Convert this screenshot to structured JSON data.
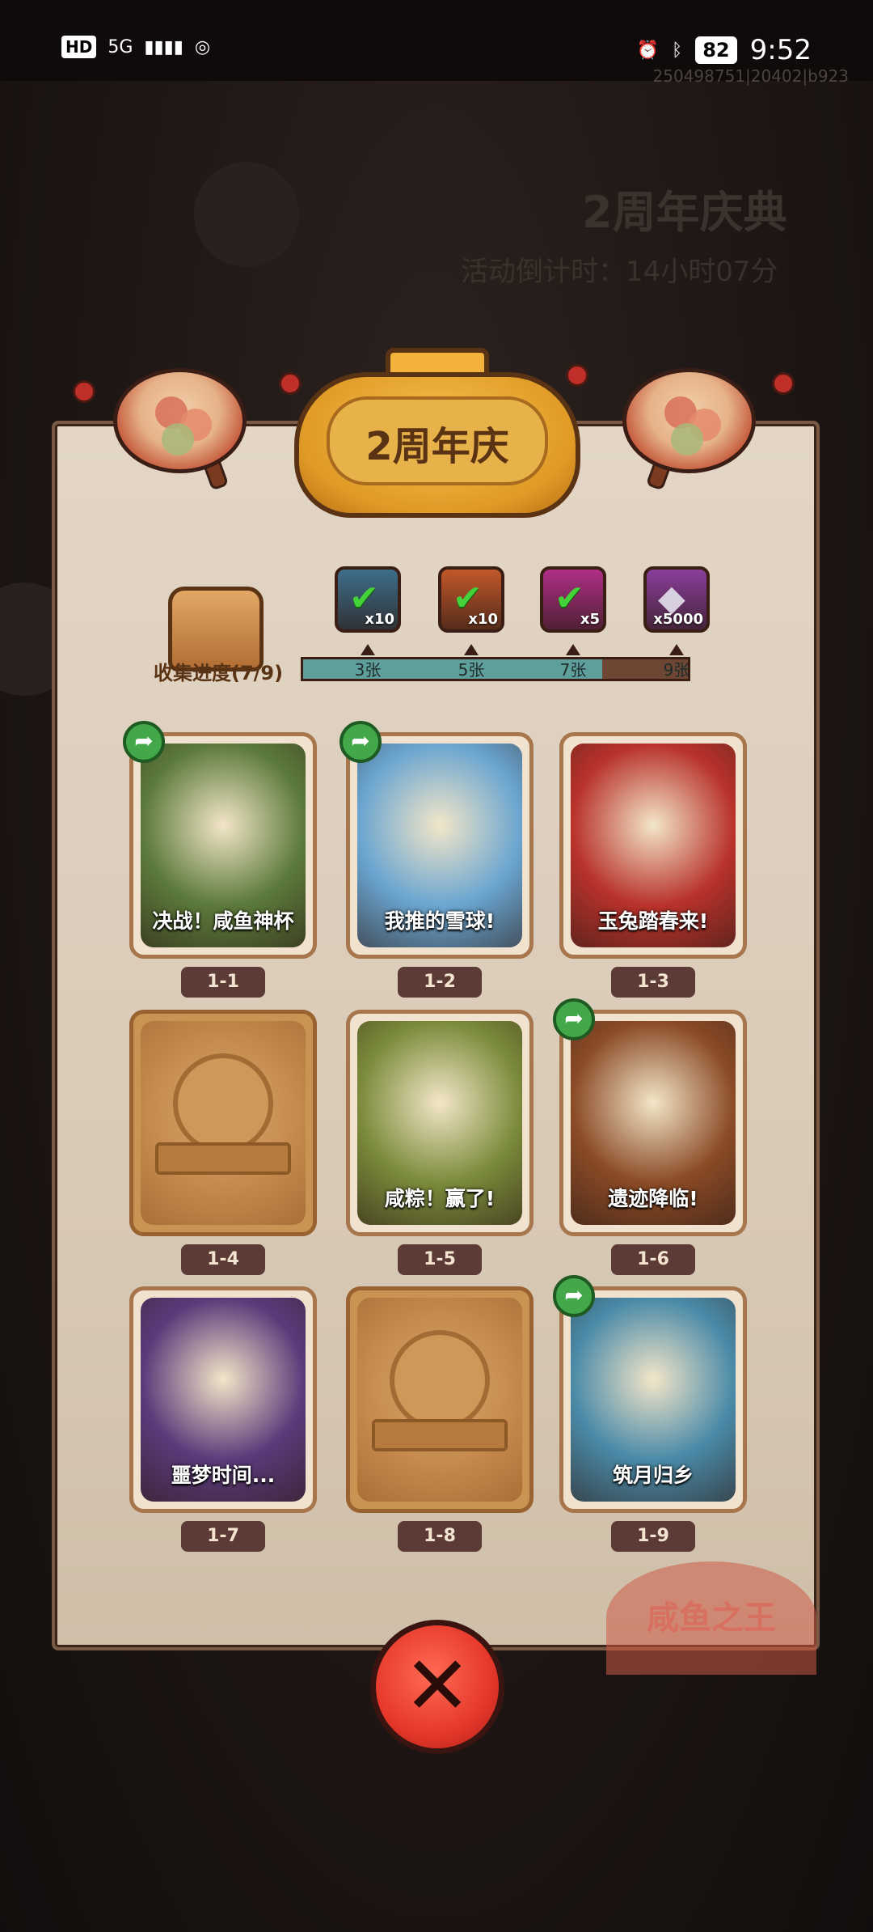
{
  "status_bar": {
    "hd": "HD",
    "signal": "5G",
    "time": "9:52",
    "battery": "82",
    "watermark": "250498751|20402|b923"
  },
  "background": {
    "event_title": "2周年庆典",
    "countdown": "活动倒计时：14小时07分"
  },
  "panel": {
    "title": "2周年庆",
    "collect_label": "收集进度(7/9)",
    "collected": 7,
    "total": 9,
    "rewards": [
      {
        "icon": "key-chest-icon",
        "qty": "x10",
        "claimed": true,
        "color": "#3d6e8a"
      },
      {
        "icon": "key-icon",
        "qty": "x10",
        "claimed": true,
        "color": "#c2582a"
      },
      {
        "icon": "orb-icon",
        "qty": "x5",
        "claimed": true,
        "color": "#b02f86"
      },
      {
        "icon": "crystal-icon",
        "qty": "x5000",
        "claimed": false,
        "color": "#8a3e9a"
      }
    ],
    "milestones": [
      "3张",
      "5张",
      "7张",
      "9张"
    ],
    "close_label": "✕",
    "stamp_text": "咸鱼之王"
  },
  "cards": [
    {
      "id": "1-1",
      "title": "决战！咸鱼神杯",
      "unlocked": true,
      "share": true,
      "color": "#5b7a3a"
    },
    {
      "id": "1-2",
      "title": "我推的雪球!",
      "unlocked": true,
      "share": true,
      "color": "#6aa5d0"
    },
    {
      "id": "1-3",
      "title": "玉兔踏春来!",
      "unlocked": true,
      "share": false,
      "color": "#b8322b"
    },
    {
      "id": "1-4",
      "title": "",
      "unlocked": false,
      "share": false,
      "color": "#c48a4c"
    },
    {
      "id": "1-5",
      "title": "咸粽！赢了!",
      "unlocked": true,
      "share": false,
      "color": "#7a8a3a"
    },
    {
      "id": "1-6",
      "title": "遗迹降临!",
      "unlocked": true,
      "share": true,
      "color": "#8a4a26"
    },
    {
      "id": "1-7",
      "title": "噩梦时间...",
      "unlocked": true,
      "share": false,
      "color": "#5b3a7a"
    },
    {
      "id": "1-8",
      "title": "",
      "unlocked": false,
      "share": false,
      "color": "#c48a4c"
    },
    {
      "id": "1-9",
      "title": "筑月归乡",
      "unlocked": true,
      "share": true,
      "color": "#4a8aa8"
    }
  ]
}
